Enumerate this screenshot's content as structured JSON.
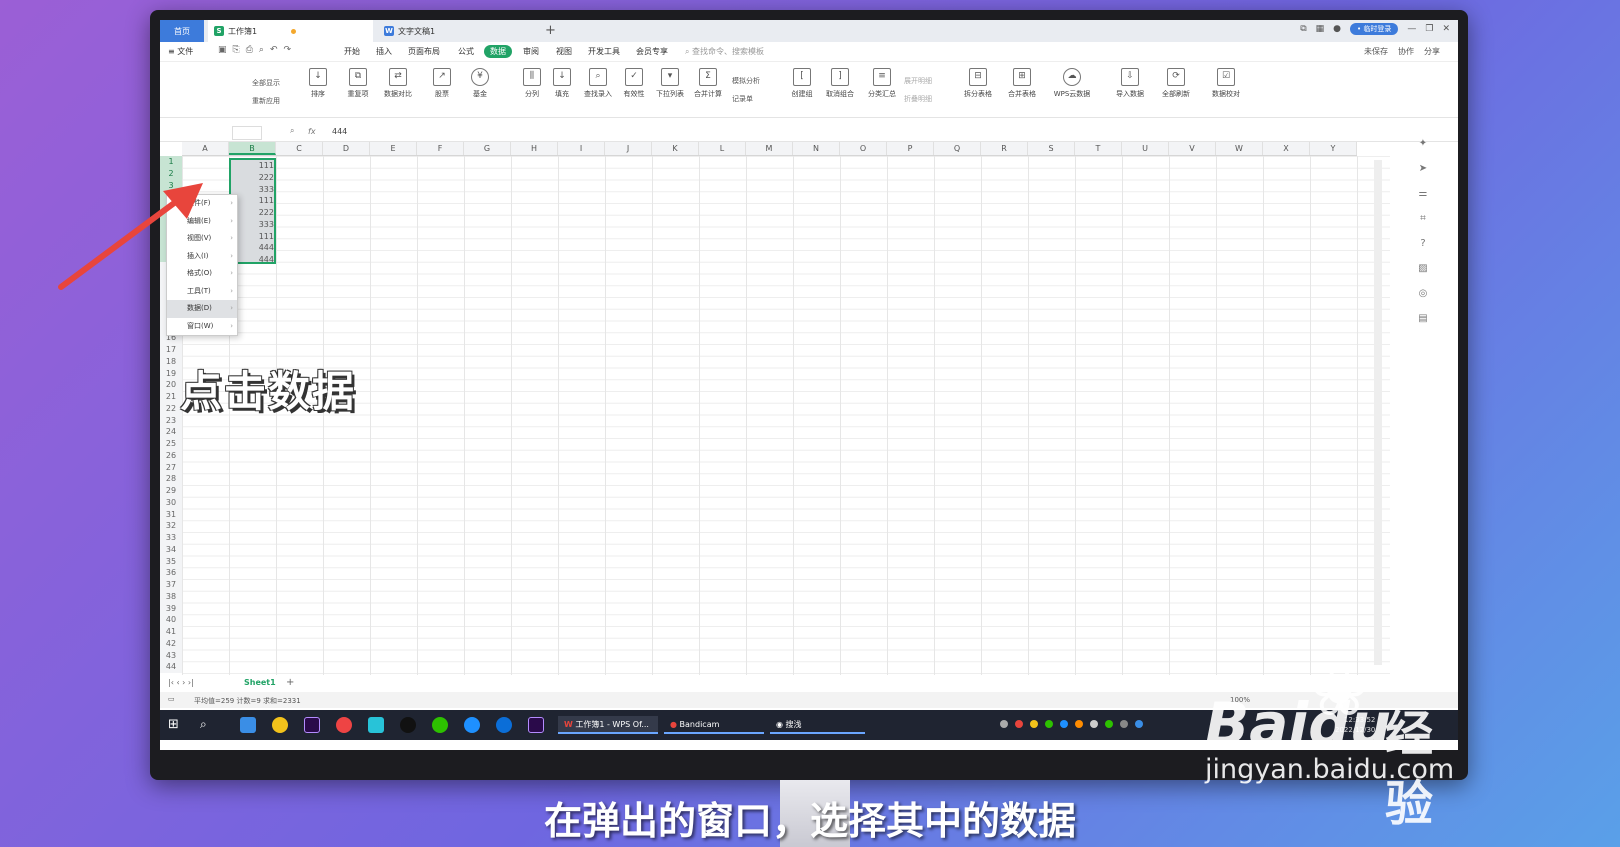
{
  "tabs": {
    "home": "首页",
    "workbook": "工作簿1",
    "doc": "文字文稿1",
    "add": "+",
    "login": "• 临时登录"
  },
  "menu": {
    "file": "≡ 文件",
    "tabs": [
      "开始",
      "插入",
      "页面布局",
      "公式",
      "数据",
      "审阅",
      "视图",
      "开发工具",
      "会员专享"
    ],
    "active_tab": "数据",
    "search": "查找命令、搜索模板",
    "right": [
      "未保存",
      "协作",
      "分享"
    ]
  },
  "ribbon": {
    "buttons": [
      "排序",
      "重复项",
      "数据对比",
      "股票",
      "基金",
      "分列",
      "填充",
      "查找录入",
      "有效性",
      "下拉列表",
      "合并计算",
      "创建组",
      "取消组合",
      "分类汇总",
      "拆分表格",
      "合并表格",
      "WPS云数据",
      "导入数据",
      "全部刷新",
      "数据校对"
    ],
    "small": [
      "全部显示",
      "重新应用",
      "模拟分析",
      "记录单",
      "展开明细",
      "折叠明细"
    ]
  },
  "formula": {
    "fx": "fx",
    "value": "444"
  },
  "columns": [
    "A",
    "B",
    "C",
    "D",
    "E",
    "F",
    "G",
    "H",
    "I",
    "J",
    "K",
    "L",
    "M",
    "N",
    "O",
    "P",
    "Q",
    "R",
    "S",
    "T",
    "U",
    "V",
    "W",
    "X",
    "Y"
  ],
  "selected_column": "B",
  "cell_values": [
    "111",
    "222",
    "333",
    "111",
    "222",
    "333",
    "111",
    "444",
    "444"
  ],
  "context_menu": [
    "文件(F)",
    "编辑(E)",
    "视图(V)",
    "插入(I)",
    "格式(O)",
    "工具(T)",
    "数据(D)",
    "窗口(W)"
  ],
  "context_highlight": "数据(D)",
  "sheet_tab": "Sheet1",
  "status": {
    "text": "平均值=259  计数=9  求和=2331",
    "zoom": "100%"
  },
  "taskbar": {
    "apps": [
      "工作簿1 - WPS Of...",
      "Bandicam",
      "搜浅"
    ],
    "time": "12:33:52",
    "date": "2022/12/30"
  },
  "overlay": {
    "left_caption": "点击数据",
    "subtitle": "在弹出的窗口，选择其中的数据"
  },
  "watermark": {
    "brand": "Baidu",
    "jy": "经验",
    "url": "jingyan.baidu.com"
  },
  "colors": {
    "accent": "#21a366",
    "wps_blue": "#3d7bdb",
    "arrow": "#e8453c"
  }
}
